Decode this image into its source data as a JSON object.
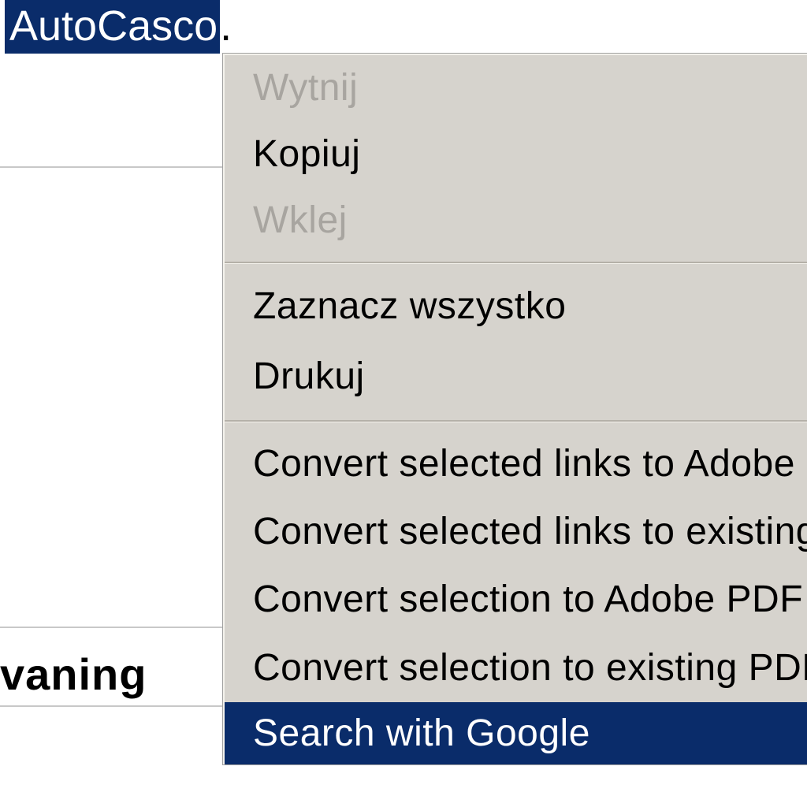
{
  "page": {
    "selected_text_prefix": "",
    "selected_text": "AutoCasco",
    "bg_word": "vaning"
  },
  "context_menu": {
    "group1": [
      {
        "label": "Wytnij",
        "disabled": true
      },
      {
        "label": "Kopiuj",
        "disabled": false
      },
      {
        "label": "Wklej",
        "disabled": true
      }
    ],
    "group2": [
      {
        "label": "Zaznacz wszystko"
      },
      {
        "label": "Drukuj"
      }
    ],
    "group3": [
      {
        "label": "Convert selected links to Adobe PDF"
      },
      {
        "label": "Convert selected links to existing PDF"
      },
      {
        "label": "Convert selection to Adobe PDF"
      },
      {
        "label": "Convert selection to existing PDF"
      }
    ],
    "highlighted": {
      "label": "Search with Google"
    }
  }
}
